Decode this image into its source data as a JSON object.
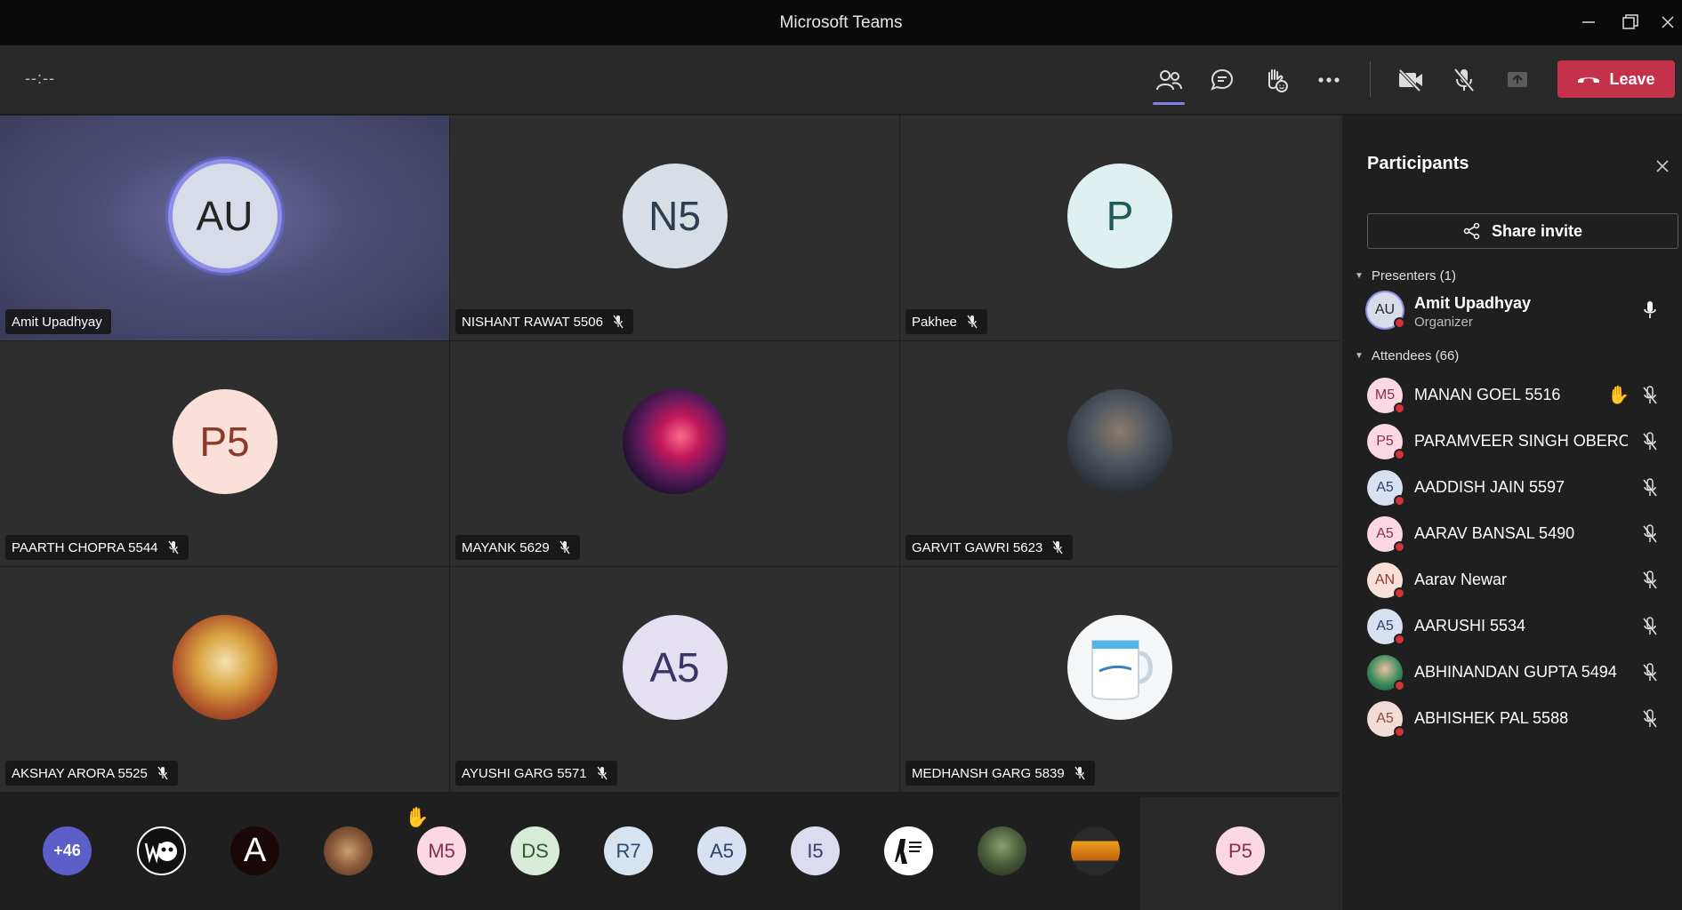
{
  "window": {
    "title": "Microsoft Teams"
  },
  "toolbar": {
    "timer": "--:--",
    "leave_label": "Leave"
  },
  "tiles": [
    {
      "name": "Amit Upadhyay",
      "initials": "AU",
      "muted": false
    },
    {
      "name": "NISHANT RAWAT 5506",
      "initials": "N5",
      "muted": true
    },
    {
      "name": "Pakhee",
      "initials": "P",
      "muted": true
    },
    {
      "name": "PAARTH CHOPRA 5544",
      "initials": "P5",
      "muted": true
    },
    {
      "name": "MAYANK 5629",
      "initials": "",
      "muted": true
    },
    {
      "name": "GARVIT GAWRI 5623",
      "initials": "",
      "muted": true
    },
    {
      "name": "AKSHAY ARORA 5525",
      "initials": "",
      "muted": true
    },
    {
      "name": "AYUSHI GARG 5571",
      "initials": "A5",
      "muted": true
    },
    {
      "name": "MEDHANSH GARG 5839",
      "initials": "",
      "muted": true
    }
  ],
  "strip": {
    "overflow": "+46",
    "chips": [
      "",
      "A",
      "",
      "M5",
      "DS",
      "R7",
      "A5",
      "I5",
      "",
      "",
      "",
      "P5"
    ]
  },
  "panel": {
    "title": "Participants",
    "share_label": "Share invite",
    "presenters_label": "Presenters (1)",
    "attendees_label": "Attendees (66)",
    "presenter": {
      "initials": "AU",
      "name": "Amit Upadhyay",
      "role": "Organizer"
    },
    "attendees": [
      {
        "initials": "M5",
        "name": "MANAN GOEL 5516",
        "hand": true
      },
      {
        "initials": "P5",
        "name": "PARAMVEER SINGH OBEROY ..."
      },
      {
        "initials": "A5",
        "name": "AADDISH JAIN 5597"
      },
      {
        "initials": "A5",
        "name": "AARAV BANSAL 5490"
      },
      {
        "initials": "AN",
        "name": "Aarav Newar"
      },
      {
        "initials": "A5",
        "name": "AARUSHI 5534"
      },
      {
        "initials": "",
        "name": "ABHINANDAN GUPTA 5494"
      },
      {
        "initials": "A5",
        "name": "ABHISHEK PAL 5588"
      }
    ]
  },
  "colors": {
    "accent": "#7b83eb",
    "leave": "#c4314b",
    "status_busy": "#d13438"
  }
}
